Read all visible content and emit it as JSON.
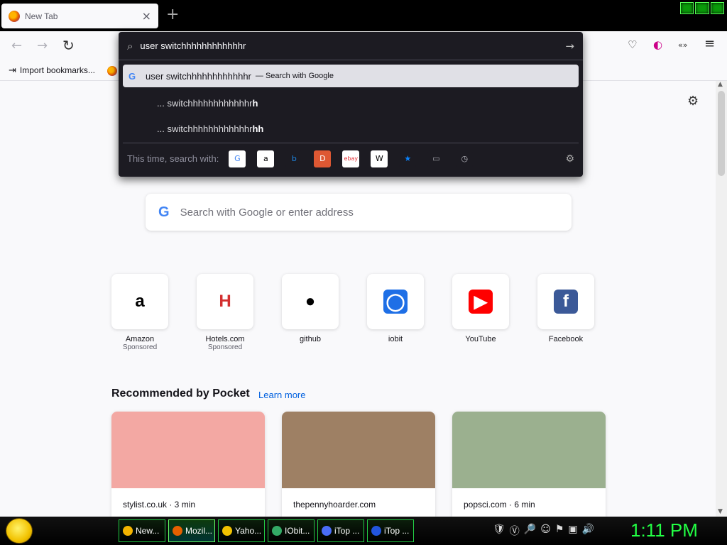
{
  "tabstrip": {
    "tab_title": "New Tab",
    "tab_close_icon": "×",
    "new_tab_icon": "+"
  },
  "toolbar": {
    "back_icon": "←",
    "forward_icon": "→",
    "reload_icon": "↻",
    "pocket_icon": "♡",
    "account_icon": "◐",
    "extensions_icon": "«»",
    "menu_icon": "≡"
  },
  "bookmarks": {
    "import_icon": "⇥",
    "import_label": "Import bookmarks..."
  },
  "urlbar": {
    "value": "user switchhhhhhhhhhhhr",
    "suggestions": [
      {
        "prefix": "G",
        "text": "user switchhhhhhhhhhhhr",
        "action": "— Search with Google"
      },
      {
        "text_plain": "... switchhhhhhhhhhhhr",
        "text_bold": "h"
      },
      {
        "text_plain": "... switchhhhhhhhhhhhr",
        "text_bold": "hh"
      }
    ],
    "oneoff_label": "This time, search with:",
    "oneoffs": [
      {
        "label": "G",
        "color": "#ffffff",
        "fg": "#4285f4"
      },
      {
        "label": "a",
        "color": "#ffffff",
        "fg": "#000000"
      },
      {
        "label": "b",
        "color": "#1c1b22",
        "fg": "#1e88e5"
      },
      {
        "label": "D",
        "color": "#de5833",
        "fg": "#ffffff"
      },
      {
        "label": "ebay",
        "color": "#ffffff",
        "fg": "#e53238"
      },
      {
        "label": "W",
        "color": "#ffffff",
        "fg": "#000000"
      },
      {
        "label": "★",
        "color": "#1c1b22",
        "fg": "#0a84ff"
      },
      {
        "label": "▭",
        "color": "#1c1b22",
        "fg": "#b0b0b8"
      },
      {
        "label": "◷",
        "color": "#1c1b22",
        "fg": "#b0b0b8"
      }
    ]
  },
  "newtab": {
    "search_logo": "G",
    "search_placeholder": "Search with Google or enter address",
    "top_sites": [
      {
        "name": "Amazon",
        "sub": "Sponsored",
        "glyph": "a",
        "color": "#000000",
        "bg": "#ffffff"
      },
      {
        "name": "Hotels.com",
        "sub": "Sponsored",
        "glyph": "H",
        "color": "#d32f2f",
        "bg": "#ffffff"
      },
      {
        "name": "github",
        "sub": "",
        "glyph": "●",
        "color": "#000000",
        "bg": "#ffffff"
      },
      {
        "name": "iobit",
        "sub": "",
        "glyph": "◯",
        "color": "#ffffff",
        "bg": "#1e6fe6"
      },
      {
        "name": "YouTube",
        "sub": "",
        "glyph": "▶",
        "color": "#ffffff",
        "bg": "#ff0000"
      },
      {
        "name": "Facebook",
        "sub": "",
        "glyph": "f",
        "color": "#ffffff",
        "bg": "#3b5998"
      }
    ],
    "pocket_title": "Recommended by Pocket",
    "pocket_link": "Learn more",
    "cards": [
      {
        "source": "stylist.co.uk · 3 min",
        "bg": "#f3a8a3"
      },
      {
        "source": "thepennyhoarder.com",
        "bg": "#9e8064"
      },
      {
        "source": "popsci.com · 6 min",
        "bg": "#9bb08f"
      }
    ]
  },
  "taskbar": {
    "tasks": [
      {
        "label": "New...",
        "icon_color": "#f4b400"
      },
      {
        "label": "Mozil...",
        "icon_color": "#e66000",
        "active": true
      },
      {
        "label": "Yaho...",
        "icon_color": "#f2c200"
      },
      {
        "label": "IObit...",
        "icon_color": "#33aa66"
      },
      {
        "label": "iTop ...",
        "icon_color": "#4a6cf7"
      },
      {
        "label": "iTop ...",
        "icon_color": "#2255dd"
      }
    ],
    "tray_icons": [
      "🛡",
      "Ⓥ",
      "🔎",
      "☺",
      "⚑",
      "▣",
      "🔊"
    ],
    "clock": "1:11 PM"
  },
  "colors": {
    "accent_link": "#0060df",
    "panel_bg": "#1c1b22",
    "clock": "#22ff44"
  }
}
